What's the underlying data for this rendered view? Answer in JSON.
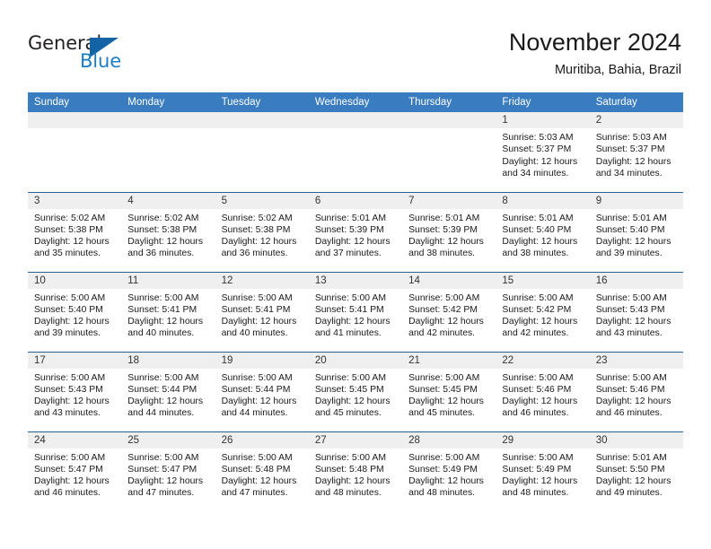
{
  "brand": {
    "name_top": "General",
    "name_bottom": "Blue",
    "triangle_color": "#1464a5",
    "blue_color": "#1b7dc4"
  },
  "header": {
    "title": "November 2024",
    "location": "Muritiba, Bahia, Brazil"
  },
  "theme": {
    "header_blue": "#3a7cc0",
    "row_divider": "#2b5f94",
    "daynum_band": "#efefef"
  },
  "weekday_headers": [
    "Sunday",
    "Monday",
    "Tuesday",
    "Wednesday",
    "Thursday",
    "Friday",
    "Saturday"
  ],
  "labels": {
    "sunrise_prefix": "Sunrise:",
    "sunset_prefix": "Sunset:",
    "daylight_prefix": "Daylight:"
  },
  "weeks": [
    [
      {
        "empty": true
      },
      {
        "empty": true
      },
      {
        "empty": true
      },
      {
        "empty": true
      },
      {
        "empty": true
      },
      {
        "day": "1",
        "sunrise": "Sunrise: 5:03 AM",
        "sunset": "Sunset: 5:37 PM",
        "daylight_l1": "Daylight: 12 hours",
        "daylight_l2": "and 34 minutes."
      },
      {
        "day": "2",
        "sunrise": "Sunrise: 5:03 AM",
        "sunset": "Sunset: 5:37 PM",
        "daylight_l1": "Daylight: 12 hours",
        "daylight_l2": "and 34 minutes."
      }
    ],
    [
      {
        "day": "3",
        "sunrise": "Sunrise: 5:02 AM",
        "sunset": "Sunset: 5:38 PM",
        "daylight_l1": "Daylight: 12 hours",
        "daylight_l2": "and 35 minutes."
      },
      {
        "day": "4",
        "sunrise": "Sunrise: 5:02 AM",
        "sunset": "Sunset: 5:38 PM",
        "daylight_l1": "Daylight: 12 hours",
        "daylight_l2": "and 36 minutes."
      },
      {
        "day": "5",
        "sunrise": "Sunrise: 5:02 AM",
        "sunset": "Sunset: 5:38 PM",
        "daylight_l1": "Daylight: 12 hours",
        "daylight_l2": "and 36 minutes."
      },
      {
        "day": "6",
        "sunrise": "Sunrise: 5:01 AM",
        "sunset": "Sunset: 5:39 PM",
        "daylight_l1": "Daylight: 12 hours",
        "daylight_l2": "and 37 minutes."
      },
      {
        "day": "7",
        "sunrise": "Sunrise: 5:01 AM",
        "sunset": "Sunset: 5:39 PM",
        "daylight_l1": "Daylight: 12 hours",
        "daylight_l2": "and 38 minutes."
      },
      {
        "day": "8",
        "sunrise": "Sunrise: 5:01 AM",
        "sunset": "Sunset: 5:40 PM",
        "daylight_l1": "Daylight: 12 hours",
        "daylight_l2": "and 38 minutes."
      },
      {
        "day": "9",
        "sunrise": "Sunrise: 5:01 AM",
        "sunset": "Sunset: 5:40 PM",
        "daylight_l1": "Daylight: 12 hours",
        "daylight_l2": "and 39 minutes."
      }
    ],
    [
      {
        "day": "10",
        "sunrise": "Sunrise: 5:00 AM",
        "sunset": "Sunset: 5:40 PM",
        "daylight_l1": "Daylight: 12 hours",
        "daylight_l2": "and 39 minutes."
      },
      {
        "day": "11",
        "sunrise": "Sunrise: 5:00 AM",
        "sunset": "Sunset: 5:41 PM",
        "daylight_l1": "Daylight: 12 hours",
        "daylight_l2": "and 40 minutes."
      },
      {
        "day": "12",
        "sunrise": "Sunrise: 5:00 AM",
        "sunset": "Sunset: 5:41 PM",
        "daylight_l1": "Daylight: 12 hours",
        "daylight_l2": "and 40 minutes."
      },
      {
        "day": "13",
        "sunrise": "Sunrise: 5:00 AM",
        "sunset": "Sunset: 5:41 PM",
        "daylight_l1": "Daylight: 12 hours",
        "daylight_l2": "and 41 minutes."
      },
      {
        "day": "14",
        "sunrise": "Sunrise: 5:00 AM",
        "sunset": "Sunset: 5:42 PM",
        "daylight_l1": "Daylight: 12 hours",
        "daylight_l2": "and 42 minutes."
      },
      {
        "day": "15",
        "sunrise": "Sunrise: 5:00 AM",
        "sunset": "Sunset: 5:42 PM",
        "daylight_l1": "Daylight: 12 hours",
        "daylight_l2": "and 42 minutes."
      },
      {
        "day": "16",
        "sunrise": "Sunrise: 5:00 AM",
        "sunset": "Sunset: 5:43 PM",
        "daylight_l1": "Daylight: 12 hours",
        "daylight_l2": "and 43 minutes."
      }
    ],
    [
      {
        "day": "17",
        "sunrise": "Sunrise: 5:00 AM",
        "sunset": "Sunset: 5:43 PM",
        "daylight_l1": "Daylight: 12 hours",
        "daylight_l2": "and 43 minutes."
      },
      {
        "day": "18",
        "sunrise": "Sunrise: 5:00 AM",
        "sunset": "Sunset: 5:44 PM",
        "daylight_l1": "Daylight: 12 hours",
        "daylight_l2": "and 44 minutes."
      },
      {
        "day": "19",
        "sunrise": "Sunrise: 5:00 AM",
        "sunset": "Sunset: 5:44 PM",
        "daylight_l1": "Daylight: 12 hours",
        "daylight_l2": "and 44 minutes."
      },
      {
        "day": "20",
        "sunrise": "Sunrise: 5:00 AM",
        "sunset": "Sunset: 5:45 PM",
        "daylight_l1": "Daylight: 12 hours",
        "daylight_l2": "and 45 minutes."
      },
      {
        "day": "21",
        "sunrise": "Sunrise: 5:00 AM",
        "sunset": "Sunset: 5:45 PM",
        "daylight_l1": "Daylight: 12 hours",
        "daylight_l2": "and 45 minutes."
      },
      {
        "day": "22",
        "sunrise": "Sunrise: 5:00 AM",
        "sunset": "Sunset: 5:46 PM",
        "daylight_l1": "Daylight: 12 hours",
        "daylight_l2": "and 46 minutes."
      },
      {
        "day": "23",
        "sunrise": "Sunrise: 5:00 AM",
        "sunset": "Sunset: 5:46 PM",
        "daylight_l1": "Daylight: 12 hours",
        "daylight_l2": "and 46 minutes."
      }
    ],
    [
      {
        "day": "24",
        "sunrise": "Sunrise: 5:00 AM",
        "sunset": "Sunset: 5:47 PM",
        "daylight_l1": "Daylight: 12 hours",
        "daylight_l2": "and 46 minutes."
      },
      {
        "day": "25",
        "sunrise": "Sunrise: 5:00 AM",
        "sunset": "Sunset: 5:47 PM",
        "daylight_l1": "Daylight: 12 hours",
        "daylight_l2": "and 47 minutes."
      },
      {
        "day": "26",
        "sunrise": "Sunrise: 5:00 AM",
        "sunset": "Sunset: 5:48 PM",
        "daylight_l1": "Daylight: 12 hours",
        "daylight_l2": "and 47 minutes."
      },
      {
        "day": "27",
        "sunrise": "Sunrise: 5:00 AM",
        "sunset": "Sunset: 5:48 PM",
        "daylight_l1": "Daylight: 12 hours",
        "daylight_l2": "and 48 minutes."
      },
      {
        "day": "28",
        "sunrise": "Sunrise: 5:00 AM",
        "sunset": "Sunset: 5:49 PM",
        "daylight_l1": "Daylight: 12 hours",
        "daylight_l2": "and 48 minutes."
      },
      {
        "day": "29",
        "sunrise": "Sunrise: 5:00 AM",
        "sunset": "Sunset: 5:49 PM",
        "daylight_l1": "Daylight: 12 hours",
        "daylight_l2": "and 48 minutes."
      },
      {
        "day": "30",
        "sunrise": "Sunrise: 5:01 AM",
        "sunset": "Sunset: 5:50 PM",
        "daylight_l1": "Daylight: 12 hours",
        "daylight_l2": "and 49 minutes."
      }
    ]
  ]
}
